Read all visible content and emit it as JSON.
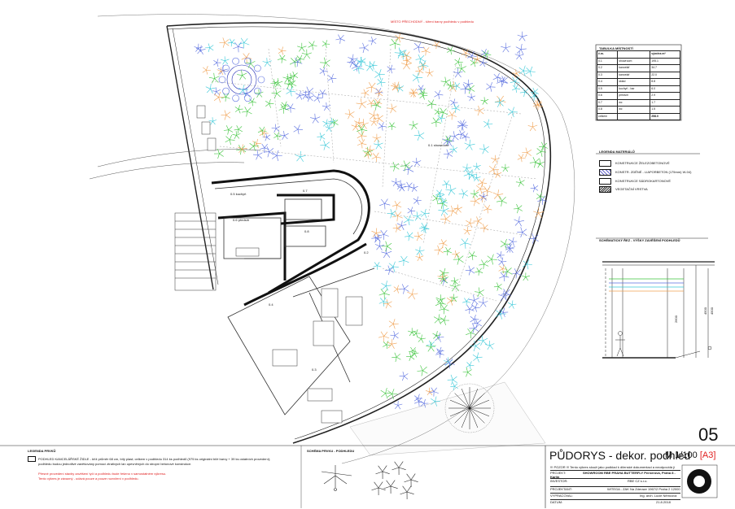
{
  "plan": {
    "top_note": "MÍSTO PŘECHODNÝ - šíření barvy podhledu v podhledu",
    "room_labels": [
      {
        "id": "0.1",
        "name": "showroom"
      },
      {
        "id": "0.2",
        "name": "kancelář"
      },
      {
        "id": "0.3",
        "name": "kancelář"
      },
      {
        "id": "0.4",
        "name": "sklad"
      },
      {
        "id": "0.5",
        "name": "kuchyň"
      },
      {
        "id": "0.6",
        "name": "předsíň"
      },
      {
        "id": "0.7",
        "name": "wc"
      },
      {
        "id": "0.8",
        "name": "wc"
      }
    ]
  },
  "room_table": {
    "title": "TABULKA MÍSTNOSTÍ",
    "headers": [
      "č.m.",
      "",
      "výměra m²"
    ],
    "rows": [
      [
        "0.1",
        "showroom",
        "195.1"
      ],
      [
        "0.2",
        "kancelář",
        "34.7"
      ],
      [
        "0.3",
        "kancelář",
        "22.0"
      ],
      [
        "0.4",
        "sklad",
        "8.8"
      ],
      [
        "0.5",
        "kuchyň - bar",
        "6.0"
      ],
      [
        "0.6",
        "předsíň",
        "2.9"
      ],
      [
        "0.7",
        "wc",
        "1.7"
      ],
      [
        "0.8",
        "wc",
        "1.5"
      ]
    ],
    "total_label": "celkem",
    "total_value": "258.0"
  },
  "materials_legend": {
    "title": "LEGENDA MATERIÁLŮ",
    "items": [
      "KONSTRUKCE ŽELEZOBETONOVÉ",
      "KONSTR. ZDĚNÉ - LIAPORBETON (175mm) W-04)",
      "KONSTRUKCE SÁDROKARTONOVÉ",
      "VEGETAČNÍ VRSTVA"
    ]
  },
  "section": {
    "title": "SCHÉMATICKÝ ŘEZ - VÝŠKY ZAVĚŠENÍ PODHLEDŮ",
    "dims": [
      "4500",
      "4500",
      "2600"
    ]
  },
  "bottom_legend": {
    "title": "LEGENDA PRVKŮ",
    "line1": "PODHLED KANCELÁŘSKÉ ŽIDLE - kříž průměr 68 cm, bílý plast; celkem v podhledu 314 ks podhledů (975 ks originální bílé barvy + 39 ks ostatních provedení);",
    "line2": "podhledu budou jednotlivé zavěšovány pomocí ztrativých lan upevněných do stropní betonové konstrukce.",
    "red1": "Přesné provedení stavby zavěšení tyčí a podhledu bude řešeno v samostatném výkresu.",
    "red2": "Tento výkres je závazný - udává pouze a pouze rozvržení v podhledu."
  },
  "element_scheme": {
    "title": "SCHÉMA PRVKU - PODHLEDU"
  },
  "title_block": {
    "sheet_number": "05",
    "drawing_title": "PŮDORYS - dekor. podhled",
    "scale": "M 1/100",
    "format": "[A3]",
    "note": "!!! POZOR !!! Tento výkres slouží jako podklad k dílenské dokumentaci a neodpovídá ji",
    "rows": [
      {
        "label": "PROJEKT:",
        "value": "SHOWROOM RBE PRAHA BUTTERFLY  Pernerova, Praha 8 - Karlín"
      },
      {
        "label": "INVESTOR:",
        "value": "RBE CZ s.r.o."
      },
      {
        "label": "PROJEKTANT:",
        "value": "WITEGA - ZAK  Na Zderaze 1967/2  Praha 2  12000"
      },
      {
        "label": "VYPRACOVAL:",
        "value": "Ing. arch. Lucie Němcová"
      },
      {
        "label": "DATUM:",
        "value": "21.8.2018"
      }
    ]
  },
  "colors": {
    "green": "#3cc43c",
    "blue": "#5a6fe0",
    "cyan": "#38c8d8",
    "orange": "#f0a050",
    "line": "#333333"
  }
}
